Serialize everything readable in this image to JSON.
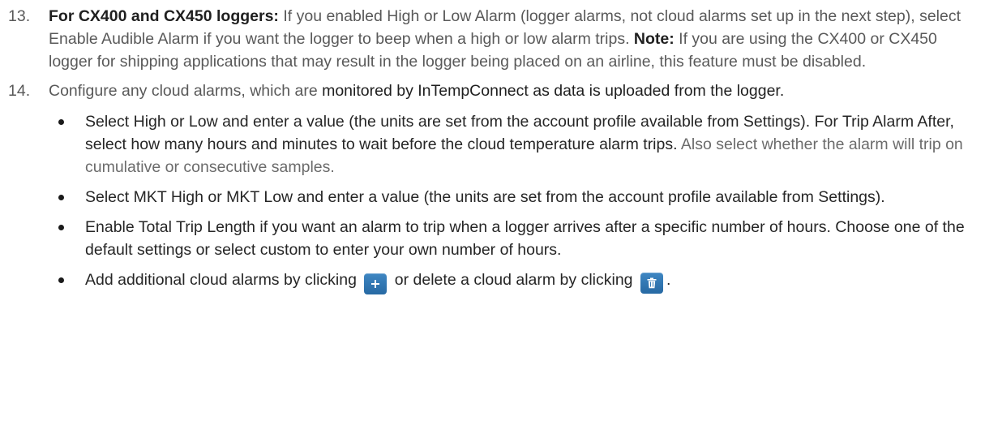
{
  "step13": {
    "number": "13.",
    "lead": "For CX400 and CX450 loggers:",
    "text": " If you enabled High or Low Alarm (logger alarms, not cloud alarms set up in the next step), select Enable Audible Alarm if you want the logger to beep when a high or low alarm trips. ",
    "note_label": "Note:",
    "note_text": " If you are using the CX400 or CX450 logger for shipping applications that may result in the logger being placed on an airline, this feature must be disabled."
  },
  "step14": {
    "number": "14.",
    "text_a": "Configure any cloud alarms, which are ",
    "text_b": "monitored by InTempConnect as data is uploaded from the logger.",
    "bullets": [
      {
        "text": "Select High or Low and enter a value (the units are set from the account profile available from Settings). For Trip Alarm After, select how many hours and minutes to wait before the cloud temperature alarm trips.",
        "text_gray": " Also select whether the alarm will trip on cumulative or consecutive samples."
      },
      {
        "text": "Select MKT High or MKT Low and enter a value (the units are set from the account profile available from Settings)."
      },
      {
        "text": "Enable Total Trip Length if you want an alarm to trip when a logger arrives after a specific number of hours. Choose one of the default settings or select custom to enter your own number of hours."
      },
      {
        "text_a": "Add additional cloud alarms by clicking ",
        "text_b": " or delete a cloud alarm by clicking ",
        "text_c": "."
      }
    ]
  },
  "icons": {
    "add": "plus-icon",
    "delete": "trash-icon",
    "button_color": "#2f77b5"
  }
}
